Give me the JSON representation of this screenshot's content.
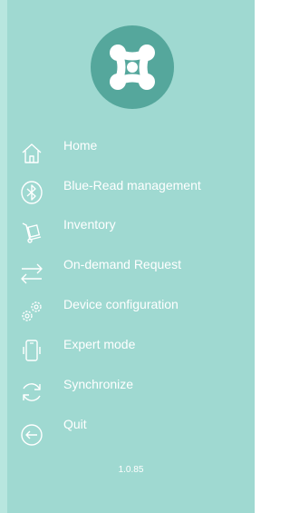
{
  "app": {
    "logo_icon": "x-logo-icon",
    "accent_color": "#55a79c",
    "drawer_color": "#9fd9d1"
  },
  "menu": {
    "items": [
      {
        "label": "Home",
        "icon": "home-icon"
      },
      {
        "label": "Blue-Read management",
        "icon": "bluetooth-icon"
      },
      {
        "label": "Inventory",
        "icon": "hand-truck-icon"
      },
      {
        "label": "On-demand Request",
        "icon": "transfer-arrows-icon"
      },
      {
        "label": "Device configuration",
        "icon": "gears-icon"
      },
      {
        "label": "Expert mode",
        "icon": "phone-icon"
      },
      {
        "label": "Synchronize",
        "icon": "sync-icon"
      },
      {
        "label": "Quit",
        "icon": "quit-icon"
      }
    ]
  },
  "footer": {
    "version": "1.0.85"
  }
}
